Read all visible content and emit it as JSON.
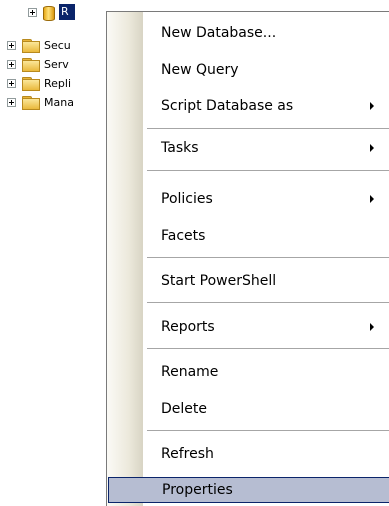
{
  "tree": {
    "database_label": "R",
    "items": [
      {
        "label": "Secu"
      },
      {
        "label": "Serv"
      },
      {
        "label": "Repli"
      },
      {
        "label": "Mana"
      }
    ]
  },
  "context_menu": {
    "items": [
      {
        "label": "New Database...",
        "has_submenu": false
      },
      {
        "label": "New Query",
        "has_submenu": false
      },
      {
        "label": "Script Database as",
        "has_submenu": true
      },
      {
        "label": "Tasks",
        "has_submenu": true
      },
      {
        "label": "Policies",
        "has_submenu": true
      },
      {
        "label": "Facets",
        "has_submenu": false
      },
      {
        "label": "Start PowerShell",
        "has_submenu": false
      },
      {
        "label": "Reports",
        "has_submenu": true
      },
      {
        "label": "Rename",
        "has_submenu": false
      },
      {
        "label": "Delete",
        "has_submenu": false
      },
      {
        "label": "Refresh",
        "has_submenu": false
      },
      {
        "label": "Properties",
        "has_submenu": false
      }
    ],
    "selected_item": "Properties"
  }
}
